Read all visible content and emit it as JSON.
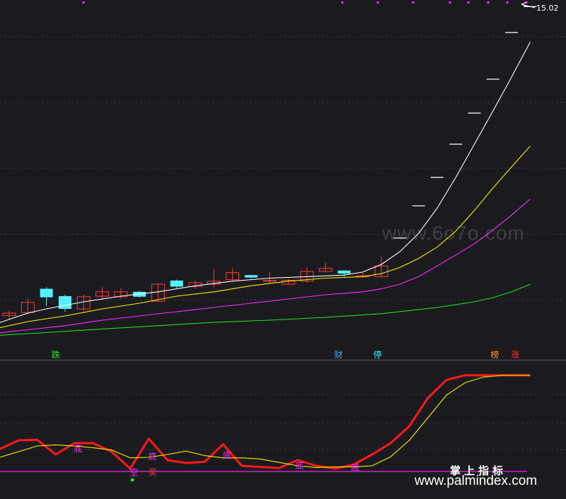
{
  "colors": {
    "background": "#1b1b1f",
    "grid": "#3a3a48",
    "up": "#ff3b3b",
    "down": "#55f0ff",
    "ma_white": "#ffffff",
    "ma_yellow": "#f6f000",
    "ma_magenta": "#ff2bff",
    "ma_green": "#22dd22",
    "indicator_red": "#ff1a1a",
    "indicator_yellow": "#f6f000",
    "baseline": "#cc22cc"
  },
  "watermarks": {
    "site_faint": "www.6o7o.com",
    "title": "掌上指标",
    "site": "www.palmindex.com"
  },
  "chart_data": [
    {
      "type": "candlestick",
      "panel": "main",
      "price_label": "15.02",
      "candles": [
        {
          "x": 1,
          "open": 2.21,
          "high": 2.38,
          "low": 2.08,
          "close": 2.3
        },
        {
          "x": 2,
          "open": 2.32,
          "high": 2.82,
          "low": 2.26,
          "close": 2.68
        },
        {
          "x": 3,
          "open": 3.15,
          "high": 3.2,
          "low": 2.55,
          "close": 2.86
        },
        {
          "x": 4,
          "open": 2.9,
          "high": 2.95,
          "low": 2.35,
          "close": 2.45
        },
        {
          "x": 5,
          "open": 2.45,
          "high": 2.95,
          "low": 2.37,
          "close": 2.88
        },
        {
          "x": 6,
          "open": 2.9,
          "high": 3.2,
          "low": 2.75,
          "close": 3.05
        },
        {
          "x": 7,
          "open": 2.88,
          "high": 3.18,
          "low": 2.8,
          "close": 3.05
        },
        {
          "x": 8,
          "open": 3.05,
          "high": 3.08,
          "low": 2.85,
          "close": 2.88
        },
        {
          "x": 9,
          "open": 2.72,
          "high": 3.35,
          "low": 2.7,
          "close": 3.3
        },
        {
          "x": 10,
          "open": 3.42,
          "high": 3.45,
          "low": 3.18,
          "close": 3.22
        },
        {
          "x": 11,
          "open": 3.22,
          "high": 3.42,
          "low": 3.15,
          "close": 3.35
        },
        {
          "x": 12,
          "open": 3.3,
          "high": 3.8,
          "low": 3.2,
          "close": 3.4
        },
        {
          "x": 13,
          "open": 3.45,
          "high": 3.82,
          "low": 3.4,
          "close": 3.68
        },
        {
          "x": 14,
          "open": 3.6,
          "high": 3.6,
          "low": 3.5,
          "close": 3.52
        },
        {
          "x": 15,
          "open": 3.43,
          "high": 3.7,
          "low": 3.3,
          "close": 3.43
        },
        {
          "x": 16,
          "open": 3.3,
          "high": 3.47,
          "low": 3.3,
          "close": 3.43
        },
        {
          "x": 17,
          "open": 3.4,
          "high": 3.85,
          "low": 3.35,
          "close": 3.72
        },
        {
          "x": 18,
          "open": 3.72,
          "high": 4.0,
          "low": 3.7,
          "close": 3.82
        },
        {
          "x": 19,
          "open": 3.75,
          "high": 3.75,
          "low": 3.55,
          "close": 3.65
        },
        {
          "x": 20,
          "open": 3.58,
          "high": 3.68,
          "low": 3.5,
          "close": 3.58
        },
        {
          "x": 21,
          "open": 3.55,
          "high": 4.28,
          "low": 3.53,
          "close": 3.9
        },
        {
          "x": 22,
          "open": 5.1,
          "high": 5.1,
          "low": 5.1,
          "close": 5.1
        },
        {
          "x": 23,
          "open": 6.5,
          "high": 6.5,
          "low": 6.5,
          "close": 6.5
        },
        {
          "x": 24,
          "open": 7.8,
          "high": 7.8,
          "low": 7.8,
          "close": 7.8
        },
        {
          "x": 25,
          "open": 9.4,
          "high": 9.4,
          "low": 9.4,
          "close": 9.4
        },
        {
          "x": 26,
          "open": 11.0,
          "high": 11.0,
          "low": 11.0,
          "close": 11.0
        },
        {
          "x": 27,
          "open": 12.6,
          "high": 12.6,
          "low": 12.6,
          "close": 12.6
        },
        {
          "x": 28,
          "open": 14.2,
          "high": 14.2,
          "low": 14.2,
          "close": 14.2
        },
        {
          "x": 29,
          "open": 15.02,
          "high": 15.02,
          "low": 15.02,
          "close": 15.02
        }
      ],
      "series": [
        {
          "color": "ma_white",
          "x": [
            0,
            2,
            3,
            5,
            7,
            9,
            11,
            13,
            15,
            17,
            19,
            20,
            21,
            22,
            23,
            24,
            25,
            26,
            27,
            28,
            29
          ],
          "values": [
            1.9,
            2.3,
            2.45,
            2.7,
            2.9,
            3.05,
            3.25,
            3.4,
            3.5,
            3.55,
            3.6,
            3.7,
            3.95,
            4.5,
            5.3,
            6.4,
            7.8,
            9.4,
            11.1,
            12.7,
            13.9
          ]
        },
        {
          "color": "ma_yellow",
          "x": [
            0,
            2,
            4,
            6,
            8,
            10,
            12,
            14,
            16,
            18,
            20,
            21,
            22,
            23,
            24,
            25,
            26,
            27,
            28,
            29
          ],
          "values": [
            1.8,
            2.0,
            2.2,
            2.45,
            2.65,
            2.9,
            3.05,
            3.25,
            3.4,
            3.5,
            3.55,
            3.65,
            3.85,
            4.2,
            4.7,
            5.4,
            6.3,
            7.3,
            8.3,
            9.3
          ]
        },
        {
          "color": "ma_magenta",
          "x": [
            0,
            2,
            4,
            6,
            8,
            10,
            12,
            14,
            16,
            18,
            20,
            21,
            22,
            23,
            24,
            25,
            26,
            27,
            28,
            29
          ],
          "values": [
            1.7,
            1.8,
            1.9,
            2.05,
            2.2,
            2.35,
            2.5,
            2.65,
            2.8,
            2.95,
            3.05,
            3.15,
            3.3,
            3.55,
            3.9,
            4.35,
            4.85,
            5.45,
            6.1,
            6.8
          ]
        },
        {
          "color": "ma_green",
          "x": [
            0,
            3,
            6,
            9,
            12,
            15,
            18,
            21,
            24,
            26,
            27,
            28,
            29
          ],
          "values": [
            1.65,
            1.73,
            1.82,
            1.9,
            1.98,
            2.05,
            2.15,
            2.28,
            2.5,
            2.7,
            2.85,
            3.05,
            3.3
          ]
        }
      ],
      "signals": [
        {
          "label": "跌",
          "x": 3.5,
          "color": "#22ee22"
        },
        {
          "label": "财",
          "x": 18.7,
          "color": "#4aa8ff"
        },
        {
          "label": "停",
          "x": 20.8,
          "color": "#33ffff"
        },
        {
          "label": "榜",
          "x": 27.1,
          "color": "#ff9933"
        },
        {
          "label": "涨",
          "x": 28.2,
          "color": "#ff3333"
        }
      ]
    },
    {
      "type": "line",
      "panel": "indicator",
      "series": [
        {
          "color": "indicator_red",
          "x": [
            0,
            1.5,
            2.5,
            3.5,
            4.5,
            5.5,
            6.5,
            7.5,
            8.5,
            9.5,
            10.5,
            11.5,
            12.5,
            13.5,
            14.5,
            15.5,
            16.5,
            17.5,
            18.5,
            19.5,
            20.5,
            21.5,
            22.5,
            23.5,
            24.5,
            25.5,
            26.5,
            27.5,
            28.5,
            29
          ],
          "values": [
            32,
            55,
            56,
            30,
            50,
            50,
            35,
            5,
            58,
            20,
            15,
            17,
            48,
            10,
            8,
            6,
            20,
            10,
            5,
            12,
            30,
            50,
            80,
            130,
            162,
            170,
            170,
            170,
            170,
            170
          ]
        },
        {
          "color": "indicator_yellow",
          "x": [
            0,
            2.5,
            3.5,
            4.5,
            5.5,
            6.5,
            7.5,
            8.5,
            9.5,
            10.5,
            11.5,
            12.5,
            13.5,
            14.5,
            15.5,
            16.5,
            17.5,
            18.5,
            19.5,
            20.5,
            21.5,
            22.5,
            23.5,
            24.5,
            25.5,
            26.5,
            27.5,
            28.5,
            29
          ],
          "values": [
            20,
            45,
            47,
            45,
            42,
            38,
            24,
            25,
            30,
            36,
            28,
            24,
            24,
            22,
            16,
            10,
            7,
            8,
            8,
            10,
            26,
            55,
            95,
            135,
            157,
            167,
            170,
            170,
            170
          ]
        }
      ],
      "markers": [
        {
          "label": "底",
          "x": 4.7,
          "value": 40,
          "color": "#ff2bff"
        },
        {
          "label": "底",
          "x": 8.7,
          "value": 26,
          "color": "#ff2bff"
        },
        {
          "label": "底",
          "x": 12.7,
          "value": 28,
          "color": "#ff2bff"
        },
        {
          "label": "底",
          "x": 16.6,
          "value": 10,
          "color": "#ff2bff"
        },
        {
          "label": "底",
          "x": 19.6,
          "value": 7,
          "color": "#ff2bff"
        },
        {
          "label": "空",
          "x": 7.7,
          "value": -2,
          "color": "#ff2bff"
        },
        {
          "label": "买",
          "x": 8.7,
          "value": -2,
          "color": "#ff3333"
        }
      ]
    }
  ]
}
